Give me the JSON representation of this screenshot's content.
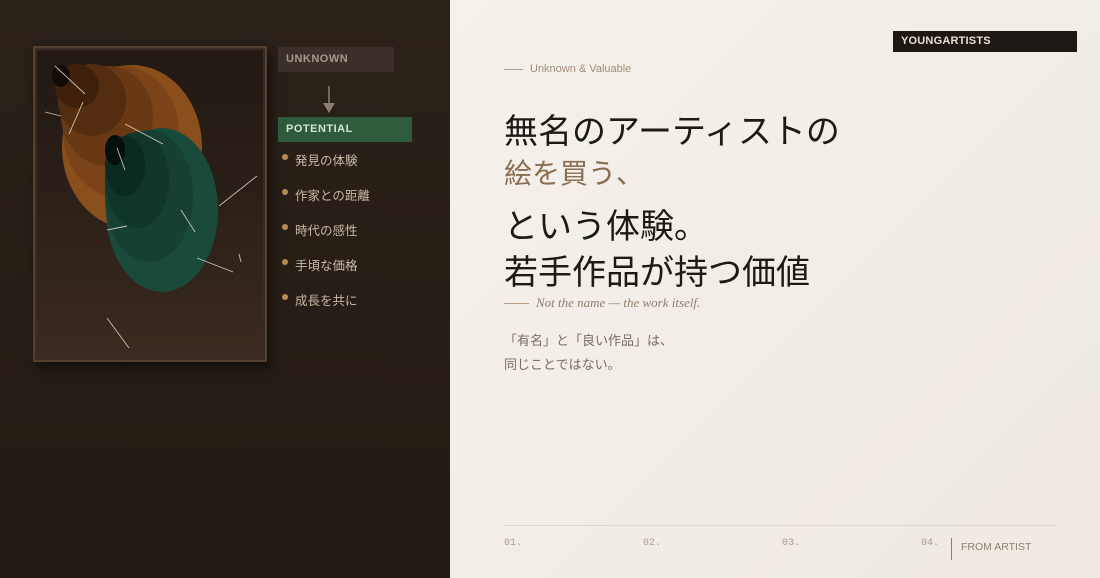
{
  "left": {
    "artwork_name": "abstract-painting",
    "tag_unknown": "UNKNOWN",
    "tag_potential": "POTENTIAL",
    "points": [
      "発見の体験",
      "作家との距離",
      "時代の感性",
      "手頃な価格",
      "成長を共に"
    ]
  },
  "right": {
    "brand": "YOUNGARTISTS",
    "eyebrow": "Unknown & Valuable",
    "headline_line1": "無名のアーティストの",
    "headline_line2": "絵を買う、",
    "headline_line3": "という体験。",
    "headline_line4": "若手作品が持つ価値",
    "subline": "Not the name — the work itself.",
    "body_line1": "「有名」と「良い作品」は、",
    "body_line2": "同じことではない。",
    "steps": [
      "01.",
      "02.",
      "03.",
      "04."
    ],
    "from_artist": "FROM ARTIST"
  },
  "colors": {
    "dark_bg": "#231a13",
    "light_bg": "#f2ede6",
    "accent_green": "#2d5b3c",
    "accent_brown": "#8a6e52"
  }
}
